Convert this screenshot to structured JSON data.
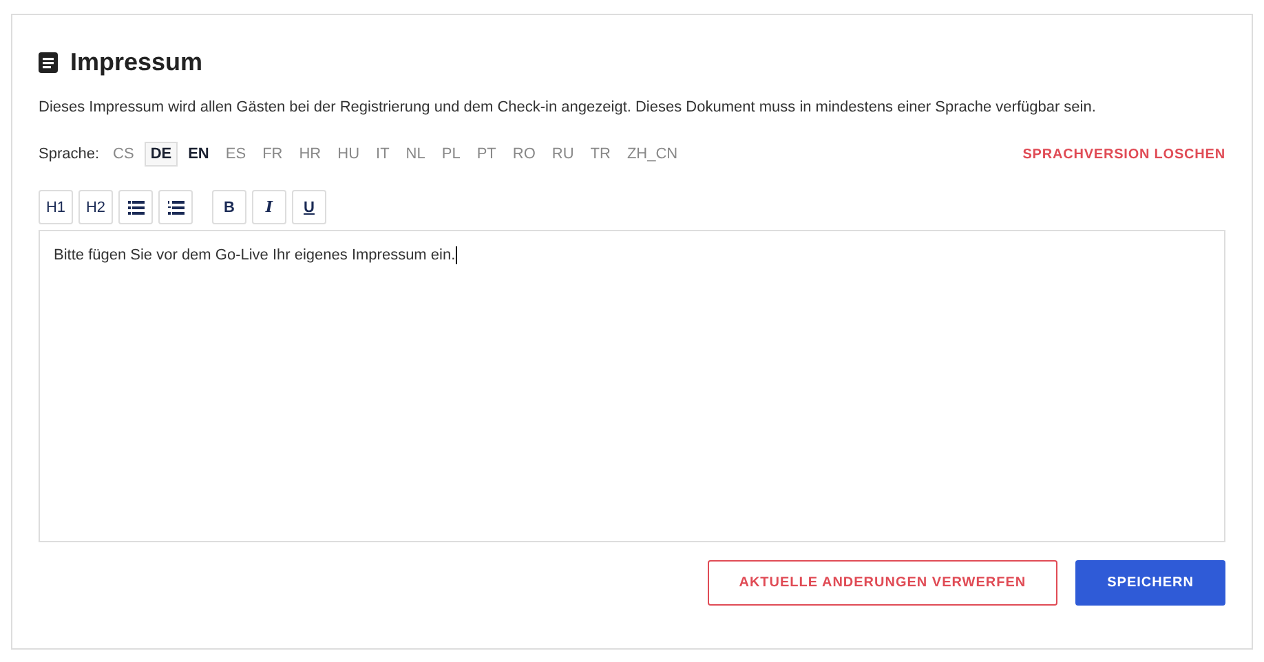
{
  "title": "Impressum",
  "description": "Dieses Impressum wird allen Gästen bei der Registrierung und dem Check-in angezeigt. Dieses Dokument muss in mindestens einer Sprache verfügbar sein.",
  "language_label": "Sprache:",
  "languages": [
    {
      "code": "CS",
      "selected": false,
      "available": false
    },
    {
      "code": "DE",
      "selected": true,
      "available": true
    },
    {
      "code": "EN",
      "selected": false,
      "available": true
    },
    {
      "code": "ES",
      "selected": false,
      "available": false
    },
    {
      "code": "FR",
      "selected": false,
      "available": false
    },
    {
      "code": "HR",
      "selected": false,
      "available": false
    },
    {
      "code": "HU",
      "selected": false,
      "available": false
    },
    {
      "code": "IT",
      "selected": false,
      "available": false
    },
    {
      "code": "NL",
      "selected": false,
      "available": false
    },
    {
      "code": "PL",
      "selected": false,
      "available": false
    },
    {
      "code": "PT",
      "selected": false,
      "available": false
    },
    {
      "code": "RO",
      "selected": false,
      "available": false
    },
    {
      "code": "RU",
      "selected": false,
      "available": false
    },
    {
      "code": "TR",
      "selected": false,
      "available": false
    },
    {
      "code": "ZH_CN",
      "selected": false,
      "available": false
    }
  ],
  "delete_language": "SPRACHVERSION LOSCHEN",
  "toolbar_groups": [
    {
      "items": [
        {
          "kind": "heading",
          "label": "H1"
        },
        {
          "kind": "heading",
          "label": "H2"
        },
        {
          "kind": "bullet-list"
        },
        {
          "kind": "numbered-list"
        }
      ]
    },
    {
      "items": [
        {
          "kind": "bold",
          "label": "B"
        },
        {
          "kind": "italic",
          "label": "I"
        },
        {
          "kind": "underline",
          "label": "U"
        }
      ]
    }
  ],
  "editor": {
    "value": "Bitte fügen Sie vor dem Go-Live Ihr eigenes Impressum ein."
  },
  "buttons": [
    {
      "kind": "danger",
      "label": "AKTUELLE ANDERUNGEN VERWERFEN"
    },
    {
      "kind": "primary",
      "label": "SPEICHERN"
    }
  ]
}
